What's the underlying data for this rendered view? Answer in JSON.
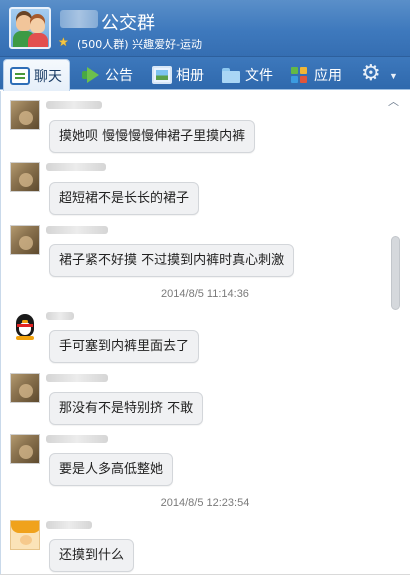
{
  "header": {
    "title": "公交群",
    "subtitle": "(500人群) 兴趣爱好-运动"
  },
  "tabs": [
    {
      "label": "聊天",
      "icon": "chat-icon",
      "active": true
    },
    {
      "label": "公告",
      "icon": "horn-icon",
      "active": false
    },
    {
      "label": "相册",
      "icon": "album-icon",
      "active": false
    },
    {
      "label": "文件",
      "icon": "folder-icon",
      "active": false
    },
    {
      "label": "应用",
      "icon": "apps-icon",
      "active": false
    }
  ],
  "messages": [
    {
      "avatar": "photo-avatar",
      "text": "摸她呗 慢慢慢慢伸裙子里摸内裤"
    },
    {
      "avatar": "photo-avatar",
      "text": "超短裙不是长长的裙子"
    },
    {
      "avatar": "photo-avatar",
      "text": "裙子紧不好摸 不过摸到内裤时真心刺激"
    },
    {
      "timestamp": "2014/8/5 11:14:36"
    },
    {
      "avatar": "penguin-avatar",
      "text": "手可塞到内裤里面去了"
    },
    {
      "avatar": "photo-avatar",
      "text": "那没有不是特别挤 不敢"
    },
    {
      "avatar": "photo-avatar",
      "text": "要是人多高低整她"
    },
    {
      "timestamp": "2014/8/5 12:23:54"
    },
    {
      "avatar": "cartoon-avatar",
      "text": "还摸到什么"
    }
  ],
  "colors": {
    "header_blue": "#3e79bd",
    "bubble_bg": "#f0f1f3",
    "timestamp_text": "#7a7a7a"
  }
}
